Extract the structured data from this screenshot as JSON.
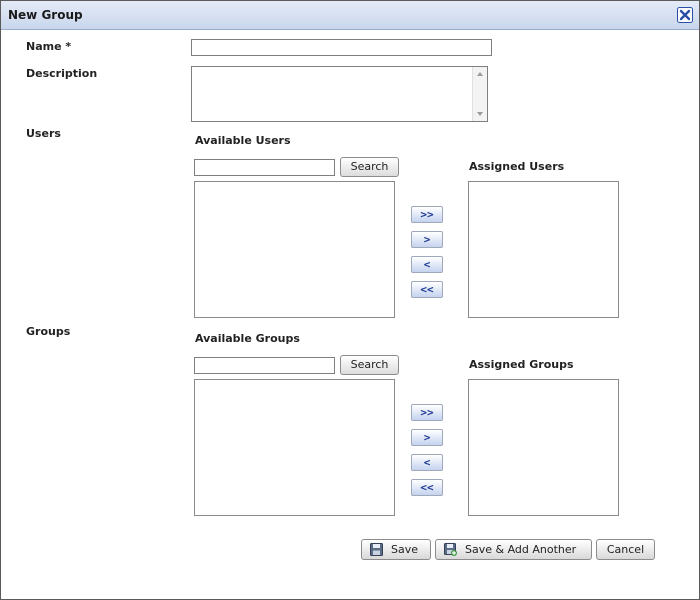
{
  "dialog": {
    "title": "New Group"
  },
  "form": {
    "name_label": "Name *",
    "name_value": "",
    "description_label": "Description",
    "description_value": "",
    "users_label": "Users",
    "groups_label": "Groups"
  },
  "users": {
    "available_label": "Available Users",
    "assigned_label": "Assigned Users",
    "search_value": "",
    "search_button": "Search",
    "available_items": [],
    "assigned_items": []
  },
  "groups": {
    "available_label": "Available Groups",
    "assigned_label": "Assigned Groups",
    "search_value": "",
    "search_button": "Search",
    "available_items": [],
    "assigned_items": []
  },
  "move_buttons": {
    "add_all": ">>",
    "add": ">",
    "remove": "<",
    "remove_all": "<<"
  },
  "actions": {
    "save": "Save",
    "save_add_another": "Save & Add Another",
    "cancel": "Cancel"
  },
  "colors": {
    "titlebar": "#c9d6ec",
    "close_icon": "#2a4ea8",
    "move_arrow": "#1f3a93"
  },
  "icons": {
    "close": "close-icon",
    "save": "floppy-disk-icon",
    "save_add": "floppy-disk-plus-icon"
  }
}
